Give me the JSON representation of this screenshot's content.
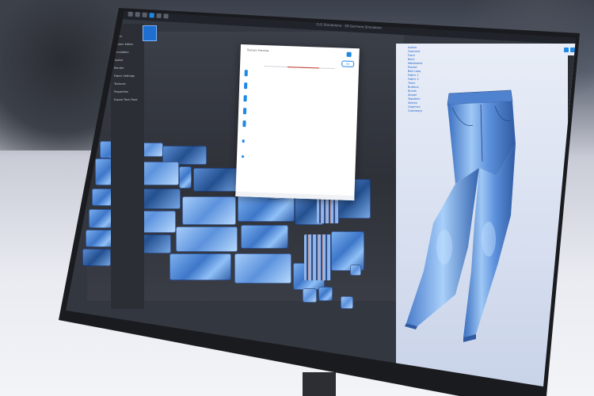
{
  "window": {
    "title": "CLO Standalone · 3D Garment Simulation"
  },
  "left_menu": {
    "items": [
      {
        "label": "Fabric"
      },
      {
        "label": "Pattern Editor"
      },
      {
        "label": "Simulation"
      },
      {
        "label": "Avatar"
      },
      {
        "label": "Render"
      },
      {
        "label": "Fabric Settings"
      },
      {
        "label": "Textures"
      },
      {
        "label": "Properties"
      },
      {
        "label": "Export Tech Pack"
      }
    ]
  },
  "dialog": {
    "title": "Texture Preview",
    "ok_label": "OK"
  },
  "object_tree": {
    "items": [
      {
        "label": "Avatar"
      },
      {
        "label": "Garment"
      },
      {
        "label": "Front"
      },
      {
        "label": "Back"
      },
      {
        "label": "Waistband"
      },
      {
        "label": "Pocket"
      },
      {
        "label": "Belt Loop"
      },
      {
        "label": "Fabric 1"
      },
      {
        "label": "Fabric 2"
      },
      {
        "label": "Trims"
      },
      {
        "label": "Buttons"
      },
      {
        "label": "Rivets"
      },
      {
        "label": "Zipper"
      },
      {
        "label": "Topstitch"
      },
      {
        "label": "Seams"
      },
      {
        "label": "Graphics"
      },
      {
        "label": "Colorways"
      }
    ]
  },
  "colors": {
    "accent": "#1e88e5",
    "denim_light": "#90c0f7",
    "denim_dark": "#2f5da6",
    "workspace": "#2e3138",
    "panel_bg": "#d6deef"
  },
  "icons": {
    "toolbar": [
      "select-icon",
      "transform-icon",
      "pen-icon",
      "sew-icon",
      "pin-icon",
      "fold-icon"
    ],
    "right_toolbar": [
      "view-icon",
      "render-icon",
      "camera-icon"
    ]
  }
}
